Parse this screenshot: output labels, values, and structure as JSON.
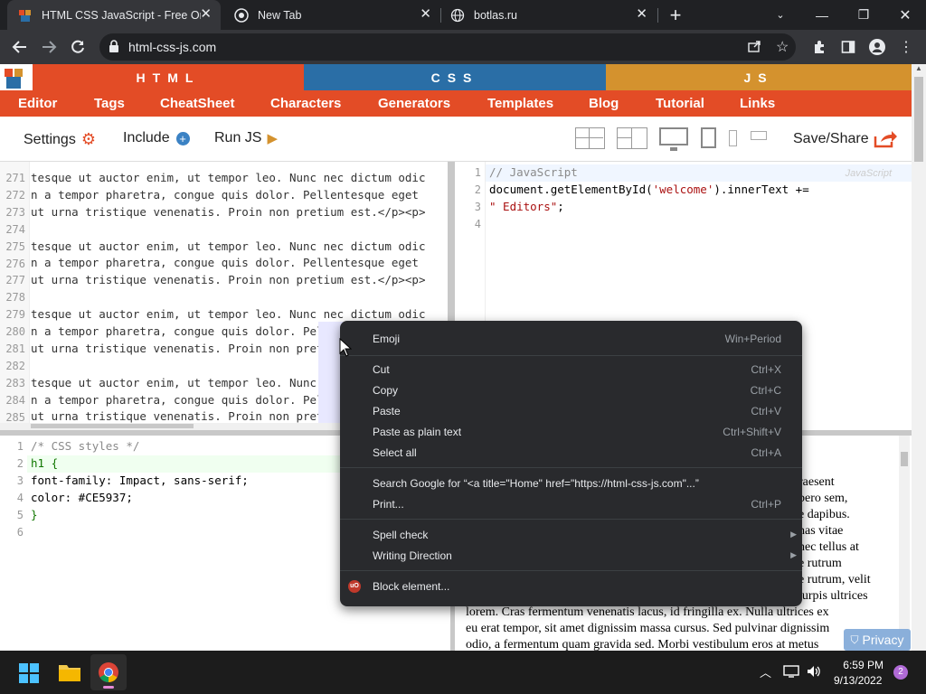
{
  "tabs": [
    {
      "title": "HTML CSS JavaScript - Free Onlin",
      "active": true
    },
    {
      "title": "New Tab",
      "active": false
    },
    {
      "title": "botlas.ru",
      "active": false
    }
  ],
  "address": {
    "url": "html-css-js.com"
  },
  "site": {
    "lang_tabs": [
      "HTML",
      "CSS",
      "JS"
    ],
    "nav": [
      "Editor",
      "Tags",
      "CheatSheet",
      "Characters",
      "Generators",
      "Templates",
      "Blog",
      "Tutorial",
      "Links"
    ],
    "controls": {
      "settings": "Settings",
      "include": "Include",
      "run": "Run JS",
      "save": "Save/Share"
    }
  },
  "html_editor": {
    "lines": [
      {
        "num": "271",
        "text": "tesque ut auctor enim, ut tempor leo. Nunc nec dictum odic"
      },
      {
        "num": "272",
        "text": "n a tempor pharetra, congue quis dolor. Pellentesque eget"
      },
      {
        "num": "273",
        "text": "ut urna tristique venenatis. Proin non pretium est.</p><p>"
      },
      {
        "num": "274",
        "text": ""
      },
      {
        "num": "275",
        "text": "tesque ut auctor enim, ut tempor leo. Nunc nec dictum odic"
      },
      {
        "num": "276",
        "text": "n a tempor pharetra, congue quis dolor. Pellentesque eget"
      },
      {
        "num": "277",
        "text": "ut urna tristique venenatis. Proin non pretium est.</p><p>"
      },
      {
        "num": "278",
        "text": ""
      },
      {
        "num": "279",
        "text": "tesque ut auctor enim, ut tempor leo. Nunc nec dictum odic"
      },
      {
        "num": "280",
        "text": "n a tempor pharetra, congue quis dolor. Pel"
      },
      {
        "num": "281",
        "text": "ut urna tristique venenatis. Proin non pret"
      },
      {
        "num": "282",
        "text": ""
      },
      {
        "num": "283",
        "text": "tesque ut auctor enim, ut tempor leo. Nunc"
      },
      {
        "num": "284",
        "text": "n a tempor pharetra, congue quis dolor. Pel"
      },
      {
        "num": "285",
        "text": "ut urna tristique venenatis. Proin non pret"
      }
    ]
  },
  "js_editor": {
    "badge": "JavaScript",
    "lines": [
      {
        "num": "1",
        "text": "// JavaScript"
      },
      {
        "num": "2",
        "text": "document.getElementById('welcome').innerText +="
      },
      {
        "num": "3",
        "text": "\" Editors\";"
      },
      {
        "num": "4",
        "text": ""
      }
    ]
  },
  "css_editor": {
    "lines": [
      {
        "num": "1",
        "text": "/* CSS styles */"
      },
      {
        "num": "2",
        "text": "h1 {"
      },
      {
        "num": "3",
        "text": "font-family: Impact, sans-serif;"
      },
      {
        "num": "4",
        "text": "color: #CE5937;"
      },
      {
        "num": "5",
        "text": "}"
      },
      {
        "num": "6",
        "text": ""
      }
    ]
  },
  "preview": {
    "right_frag": [
      "raesent",
      "bero sem,",
      "e dapibus.",
      "has vitae",
      "nec tellus at",
      "e rutrum",
      "e rutrum, velit",
      "turpis ultrices"
    ],
    "full": [
      "lorem. Cras fermentum venenatis lacus, id fringilla ex. Nulla ultrices ex",
      "eu erat tempor, sit amet dignissim massa cursus. Sed pulvinar dignissim",
      "odio, a fermentum quam gravida sed. Morbi vestibulum eros at metus"
    ],
    "privacy": "Privacy"
  },
  "context_menu": {
    "items": [
      {
        "label": "Emoji",
        "shortcut": "Win+Period"
      },
      {
        "label": "Cut",
        "shortcut": "Ctrl+X"
      },
      {
        "label": "Copy",
        "shortcut": "Ctrl+C"
      },
      {
        "label": "Paste",
        "shortcut": "Ctrl+V"
      },
      {
        "label": "Paste as plain text",
        "shortcut": "Ctrl+Shift+V"
      },
      {
        "label": "Select all",
        "shortcut": "Ctrl+A"
      },
      {
        "label": "Search Google for “<a title=\"Home\" href=\"https://html-css-js.com\"...”",
        "shortcut": ""
      },
      {
        "label": "Print...",
        "shortcut": "Ctrl+P"
      },
      {
        "label": "Spell check",
        "shortcut": ""
      },
      {
        "label": "Writing Direction",
        "shortcut": ""
      },
      {
        "label": "Block element...",
        "shortcut": ""
      }
    ]
  },
  "taskbar": {
    "time": "6:59 PM",
    "date": "9/13/2022",
    "notif_count": "2"
  },
  "colors": {
    "html": "#e34c26",
    "css": "#2a6ea6",
    "js": "#d4922e"
  }
}
